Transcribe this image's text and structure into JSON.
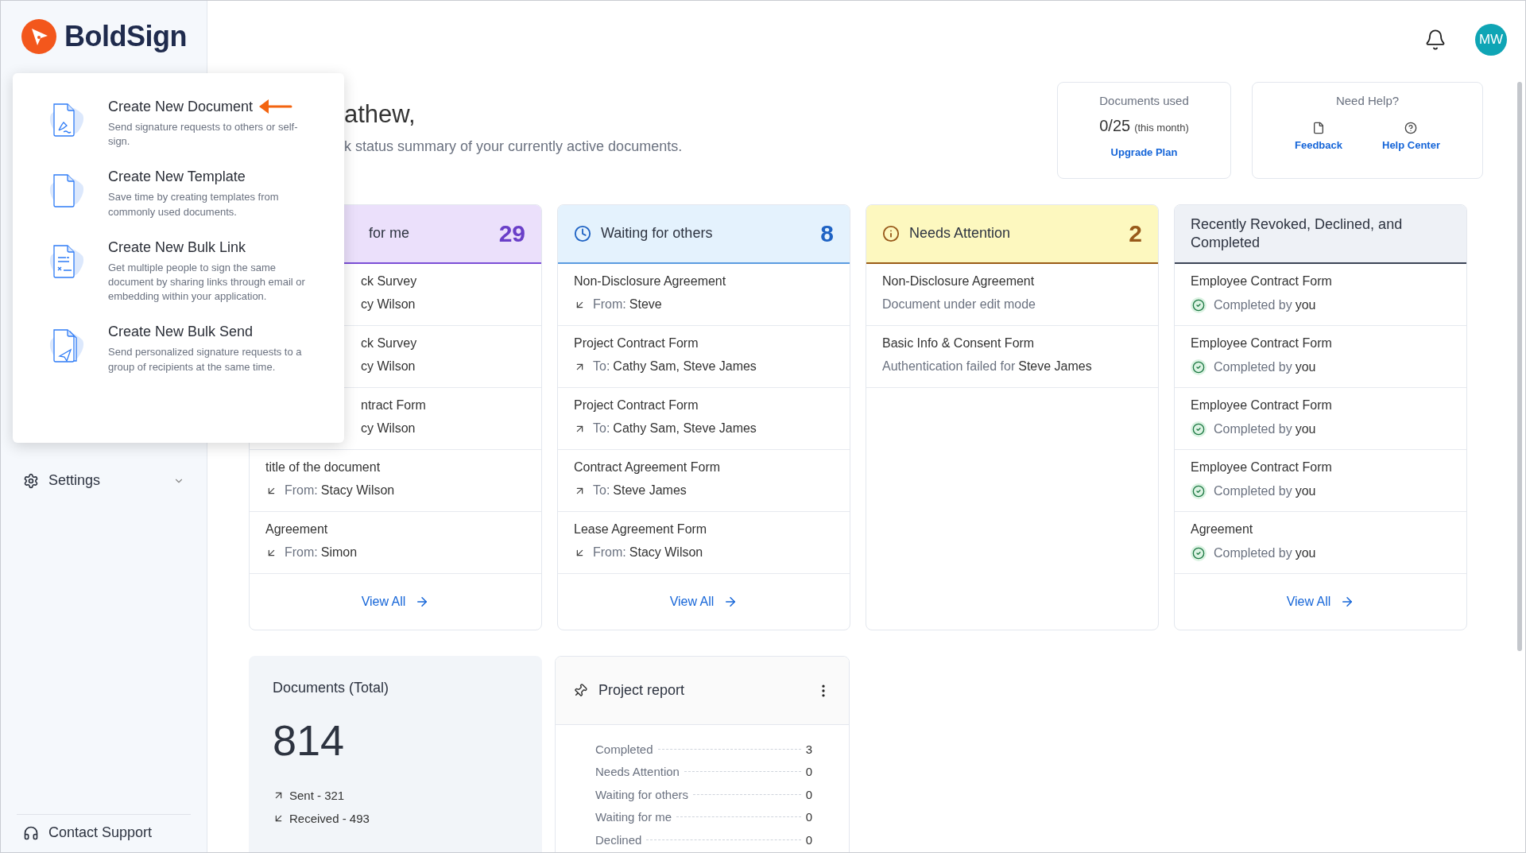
{
  "brand": {
    "name": "BoldSign"
  },
  "sidebar": {
    "items": [
      {
        "label": "Settings",
        "kind": "settings",
        "expanded": false
      }
    ],
    "footer": {
      "label": "Contact Support"
    }
  },
  "create_menu": {
    "items": [
      {
        "kind": "document",
        "title": "Create New Document",
        "description": "Send signature requests to others or self-sign.",
        "arrow": true
      },
      {
        "kind": "template",
        "title": "Create New Template",
        "description": "Save time by creating templates from commonly used documents.",
        "arrow": false
      },
      {
        "kind": "bulk_link",
        "title": "Create New Bulk Link",
        "description": "Get multiple people to sign the same document by sharing links through email or embedding within your application.",
        "arrow": false
      },
      {
        "kind": "bulk_send",
        "title": "Create New Bulk Send",
        "description": "Send personalized signature requests to a group of recipients at the same time.",
        "arrow": false
      }
    ]
  },
  "header": {
    "avatar": "MW"
  },
  "greeting": {
    "title": "athew,",
    "subtitle": "k status summary of your currently active documents."
  },
  "usage": {
    "title": "Documents used",
    "count": "0/25",
    "period": "(this month)",
    "link": "Upgrade Plan"
  },
  "help": {
    "title": "Need Help?",
    "links": [
      {
        "kind": "feedback",
        "label": "Feedback"
      },
      {
        "kind": "help",
        "label": "Help Center"
      }
    ]
  },
  "status_cards": [
    {
      "kind": "me",
      "covered": true,
      "title": "for me",
      "count": "29",
      "view_all": "View All",
      "rows": [
        {
          "covered": true,
          "kind": "partial",
          "title": "ck Survey",
          "name": "cy Wilson"
        },
        {
          "covered": true,
          "kind": "partial",
          "title": "ck Survey",
          "name": "cy Wilson"
        },
        {
          "covered": true,
          "kind": "partial",
          "title": "ntract Form",
          "name": "cy Wilson"
        },
        {
          "covered": false,
          "kind": "incoming",
          "title": "title of the document",
          "prefix": "From:",
          "name": "Stacy Wilson"
        },
        {
          "covered": false,
          "kind": "incoming",
          "title": "Agreement",
          "prefix": "From:",
          "name": "Simon"
        }
      ]
    },
    {
      "kind": "others",
      "covered": false,
      "title": "Waiting for others",
      "count": "8",
      "view_all": "View All",
      "rows": [
        {
          "kind": "incoming",
          "title": "Non-Disclosure Agreement",
          "prefix": "From:",
          "name": "Steve"
        },
        {
          "kind": "outgoing",
          "title": "Project Contract Form",
          "prefix": "To:",
          "name": "Cathy Sam, Steve James"
        },
        {
          "kind": "outgoing",
          "title": "Project Contract Form",
          "prefix": "To:",
          "name": "Cathy Sam, Steve James"
        },
        {
          "kind": "outgoing",
          "title": "Contract Agreement Form",
          "prefix": "To:",
          "name": "Steve James"
        },
        {
          "kind": "incoming",
          "title": "Lease Agreement Form",
          "prefix": "From:",
          "name": "Stacy Wilson"
        }
      ]
    },
    {
      "kind": "attention",
      "covered": false,
      "title": "Needs Attention",
      "count": "2",
      "rows": [
        {
          "kind": "note",
          "title": "Non-Disclosure Agreement",
          "prefix": "Document under edit mode"
        },
        {
          "kind": "note",
          "title": "Basic Info & Consent Form",
          "prefix": "Authentication failed for",
          "name": "Steve James"
        }
      ]
    },
    {
      "kind": "recent",
      "covered": false,
      "title": "Recently Revoked, Declined, and Completed",
      "view_all": "View All",
      "rows": [
        {
          "kind": "completed",
          "title": "Employee Contract Form",
          "prefix": "Completed by",
          "name": "you"
        },
        {
          "kind": "completed",
          "title": "Employee Contract Form",
          "prefix": "Completed by",
          "name": "you"
        },
        {
          "kind": "completed",
          "title": "Employee Contract Form",
          "prefix": "Completed by",
          "name": "you"
        },
        {
          "kind": "completed",
          "title": "Employee Contract Form",
          "prefix": "Completed by",
          "name": "you"
        },
        {
          "kind": "completed",
          "title": "Agreement",
          "prefix": "Completed by",
          "name": "you"
        }
      ]
    }
  ],
  "totals": {
    "title": "Documents (Total)",
    "count": "814",
    "lines": [
      {
        "kind": "outgoing",
        "label": "Sent - 321"
      },
      {
        "kind": "incoming",
        "label": "Received - 493"
      }
    ]
  },
  "project_report": {
    "title": "Project report",
    "rows": [
      {
        "label": "Completed",
        "value": "3"
      },
      {
        "label": "Needs Attention",
        "value": "0"
      },
      {
        "label": "Waiting for others",
        "value": "0"
      },
      {
        "label": "Waiting for me",
        "value": "0"
      },
      {
        "label": "Declined",
        "value": "0"
      }
    ]
  }
}
